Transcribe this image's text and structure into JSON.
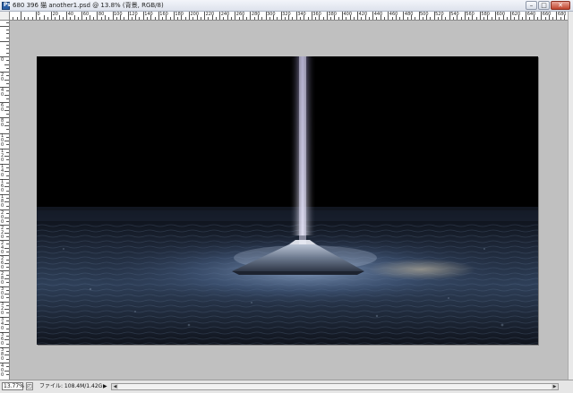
{
  "window": {
    "title": "680 396 猫  another1.psd @ 13.8% (背景, RGB/8)",
    "app_icon_letter": "Ps",
    "minimize_glyph": "–",
    "maximize_glyph": "□",
    "close_glyph": "✕"
  },
  "ruler": {
    "h_labels": [
      "0",
      "20",
      "40",
      "60",
      "80",
      "100",
      "120",
      "140",
      "160",
      "180",
      "200",
      "220",
      "240",
      "260",
      "280",
      "300",
      "320",
      "340",
      "360",
      "380",
      "400",
      "420",
      "440",
      "460",
      "480",
      "500",
      "520",
      "540",
      "560",
      "580",
      "600",
      "620",
      "640",
      "660",
      "680",
      "700",
      "720"
    ],
    "v_labels": [
      "0",
      "20",
      "40",
      "60",
      "80",
      "100",
      "120",
      "140",
      "160",
      "180",
      "200",
      "220",
      "240",
      "260",
      "280",
      "300",
      "320",
      "340",
      "360",
      "380",
      "400"
    ]
  },
  "status": {
    "zoom": "13.77%",
    "doc_info": "ファイル: 108.4M/1.42G",
    "arrow_glyph": "▶",
    "icon_glyph": "◰"
  },
  "colors": {
    "canvas_bg": "#c0c0c0",
    "document_bg": "#000000",
    "ground_top": "#1a2233",
    "ground_mid": "#3b5170",
    "beam": "#b7b4d6"
  }
}
